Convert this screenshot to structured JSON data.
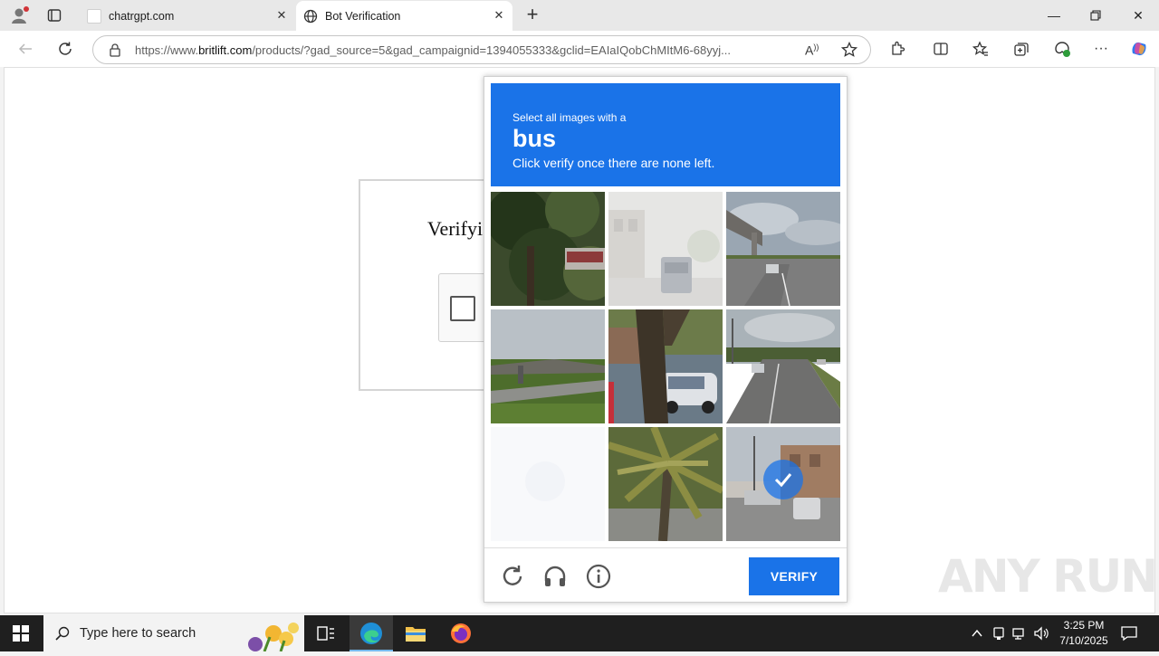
{
  "browser": {
    "tabs": [
      {
        "title": "chatrgpt.com",
        "active": false
      },
      {
        "title": "Bot Verification",
        "active": true
      }
    ],
    "url_prefix": "https://www.",
    "url_domain": "britlift.com",
    "url_rest": "/products/?gad_source=5&gad_campaignid=1394055333&gclid=EAIaIQobChMItM6-68yyj..."
  },
  "page": {
    "verify_heading": "Verifyi"
  },
  "captcha": {
    "instruction_line1": "Select all images with a",
    "keyword": "bus",
    "instruction_line2": "Click verify once there are none left.",
    "selected_tiles": [
      9
    ],
    "verify_label": "VERIFY",
    "accent_color": "#1a73e8"
  },
  "watermark": "ANY RUN",
  "taskbar": {
    "search_placeholder": "Type here to search",
    "time": "3:25 PM",
    "date": "7/10/2025"
  }
}
